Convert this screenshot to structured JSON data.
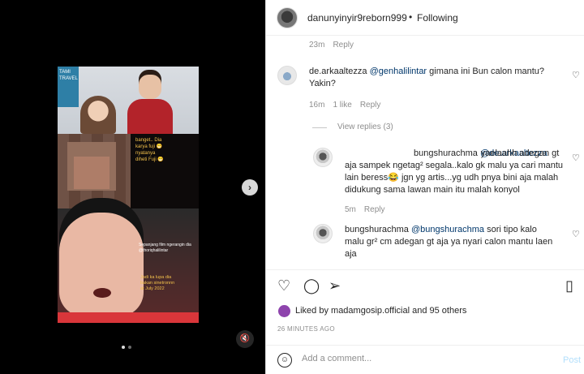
{
  "post": {
    "username": "danunyinyir9reborn999",
    "separator": "•",
    "follow_label": "Following"
  },
  "media": {
    "sign_text": "TAMI\nTRAVEL",
    "caption1": "banget.. Dia\nkarya fuji 😁\nnyatanya\ndiheti Fuji 😁",
    "caption2": "Sepanjang film ngerangin dia\n@thoriqhalilintar",
    "caption3": "Jadi ka lupa dia\nbakan sinetronnn\nat July 2022",
    "next_icon": "chevron-right-icon",
    "mute_icon": "speaker-muted-icon",
    "next_glyph": "›",
    "mute_glyph": "🔇"
  },
  "comments": {
    "top_meta": {
      "time": "23m",
      "reply": "Reply"
    },
    "c1": {
      "user": "de.arkaaltezza",
      "mention": "@genhalilintar",
      "text": " gimana ini Bun calon mantu?\nYakin?",
      "time": "16m",
      "likes": "1 like",
      "reply": "Reply"
    },
    "view_replies": "View replies (3)",
    "r1": {
      "user": "bungshurachma",
      "mention": "@de.arkaaltezza",
      "text": " yaelaahh adegan gt\naja sampek ngetag² segala..kalo gk malu ya cari mantu\nlain beress😂 jgn yg artis...yg udh pnya bini aja malah\ndidukung sama lawan main itu malah konyol",
      "time": "5m",
      "reply": "Reply"
    },
    "r2": {
      "user": "bungshurachma",
      "mention": "@bungshurachma",
      "text": " sori tipo kalo\nmalu gr² cm adegan gt aja ya nyari calon mantu laen\naja"
    },
    "heart_glyph": "♡"
  },
  "actions": {
    "like_glyph": "♡",
    "comment_glyph": "◯",
    "share_glyph": "➢",
    "save_glyph": "▯"
  },
  "likes": {
    "prefix": "Liked by ",
    "user": "madamgosip.official",
    "middle": " and ",
    "others": "95 others"
  },
  "timestamp": "26 MINUTES AGO",
  "add_comment": {
    "placeholder": "Add a comment...",
    "post_label": "Post",
    "emoji_glyph": "☺"
  },
  "carousel": {
    "total": 2,
    "active": 1
  }
}
